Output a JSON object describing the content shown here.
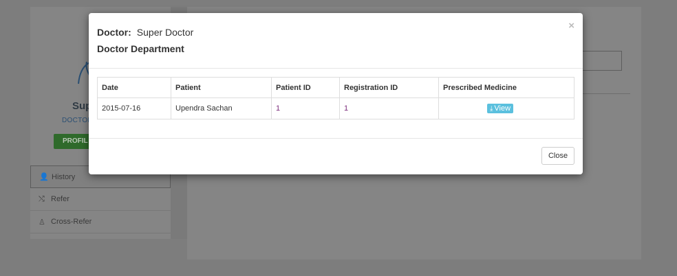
{
  "background": {
    "profile": {
      "name": "Sup",
      "role": "DOCTOR",
      "profile_button": "PROFIL"
    },
    "side_menu": [
      {
        "label": "History",
        "icon": "user-icon",
        "glyph": "👤"
      },
      {
        "label": "Refer",
        "icon": "shuffle-icon",
        "glyph": "⤭"
      },
      {
        "label": "Cross-Refer",
        "icon": "person-icon",
        "glyph": "♙"
      }
    ],
    "right_button": "on"
  },
  "modal": {
    "doctor_label": "Doctor:",
    "doctor_name": "Super Doctor",
    "department": "Doctor Department",
    "close_x": "×",
    "table": {
      "headers": [
        "Date",
        "Patient",
        "Patient ID",
        "Registration ID",
        "Prescribed Medicine"
      ],
      "rows": [
        {
          "date": "2015-07-16",
          "patient": "Upendra Sachan",
          "patient_id": "1",
          "registration_id": "1",
          "action": "View"
        }
      ]
    },
    "close_button": "Close"
  },
  "colors": {
    "overlay": "#7d7d7d",
    "view_button": "#5bc0de",
    "link": "#7a2a7a"
  }
}
